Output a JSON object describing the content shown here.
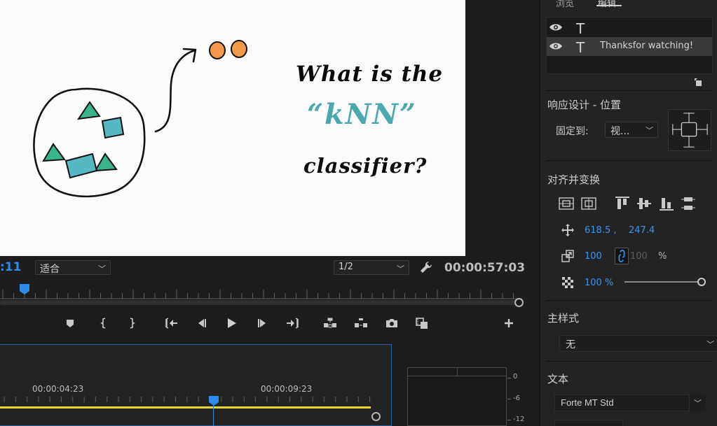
{
  "monitor": {
    "timecode_left": ":11",
    "fit_label": "适合",
    "resolution_label": "1/2",
    "timecode_right": "00:00:57:03",
    "icons": [
      "wrench-icon",
      "marker-icon",
      "mark-in-icon",
      "mark-out-icon",
      "go-to-in-icon",
      "step-back-icon",
      "play-icon",
      "step-forward-icon",
      "go-to-out-icon",
      "lift-icon",
      "extract-icon",
      "camera-icon",
      "comparison-view-icon",
      "add-button-icon"
    ]
  },
  "video": {
    "line1": "What is the",
    "line2": "“kNN”",
    "line3": "classifier?",
    "accent_color": "#4ba9ad"
  },
  "timeline": {
    "time_1": "00:00:04:23",
    "time_2": "00:00:09:23",
    "track_color": "#e6d63a",
    "playhead_color": "#2d8ceb"
  },
  "audio_meter": {
    "db_0": "0",
    "db_6": "-6",
    "db_12": "-12"
  },
  "panel": {
    "tab_browse": "浏览",
    "tab_edit": "编辑",
    "layers": [
      {
        "icon": "T",
        "label": ""
      },
      {
        "icon": "T",
        "label": "Thanksfor watching!"
      }
    ],
    "responsive_title": "响应设计 - 位置",
    "pin_label": "固定到:",
    "pin_value": "视...",
    "align_title": "对齐并变换",
    "position_x": "618.5 ,",
    "position_y": "247.4",
    "scale_value": "100",
    "scale_locked_value": "100",
    "percent": "%",
    "opacity_value": "100 %",
    "master_style_title": "主样式",
    "master_style_value": "无",
    "text_title": "文本",
    "font_value": "Forte MT Std"
  }
}
